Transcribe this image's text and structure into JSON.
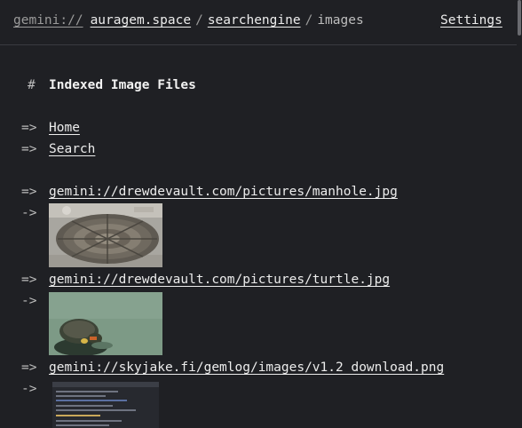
{
  "header": {
    "protocol": "gemini://",
    "host": "auragem.space",
    "separator": "/",
    "path1": "searchengine",
    "current": "images",
    "settings_label": "Settings"
  },
  "page": {
    "heading_marker": "#",
    "heading": "Indexed Image Files",
    "link_marker": "=>",
    "nav_links": [
      {
        "label": "Home"
      },
      {
        "label": "Search"
      }
    ],
    "images": [
      {
        "url": "gemini://drewdevault.com/pictures/manhole.jpg",
        "preview_alt": "manhole cover photo"
      },
      {
        "url": "gemini://drewdevault.com/pictures/turtle.jpg",
        "preview_alt": "turtle photo"
      },
      {
        "url": "gemini://skyjake.fi/gemlog/images/v1.2_download.png",
        "preview_alt": "screenshot of dark app window"
      }
    ]
  }
}
